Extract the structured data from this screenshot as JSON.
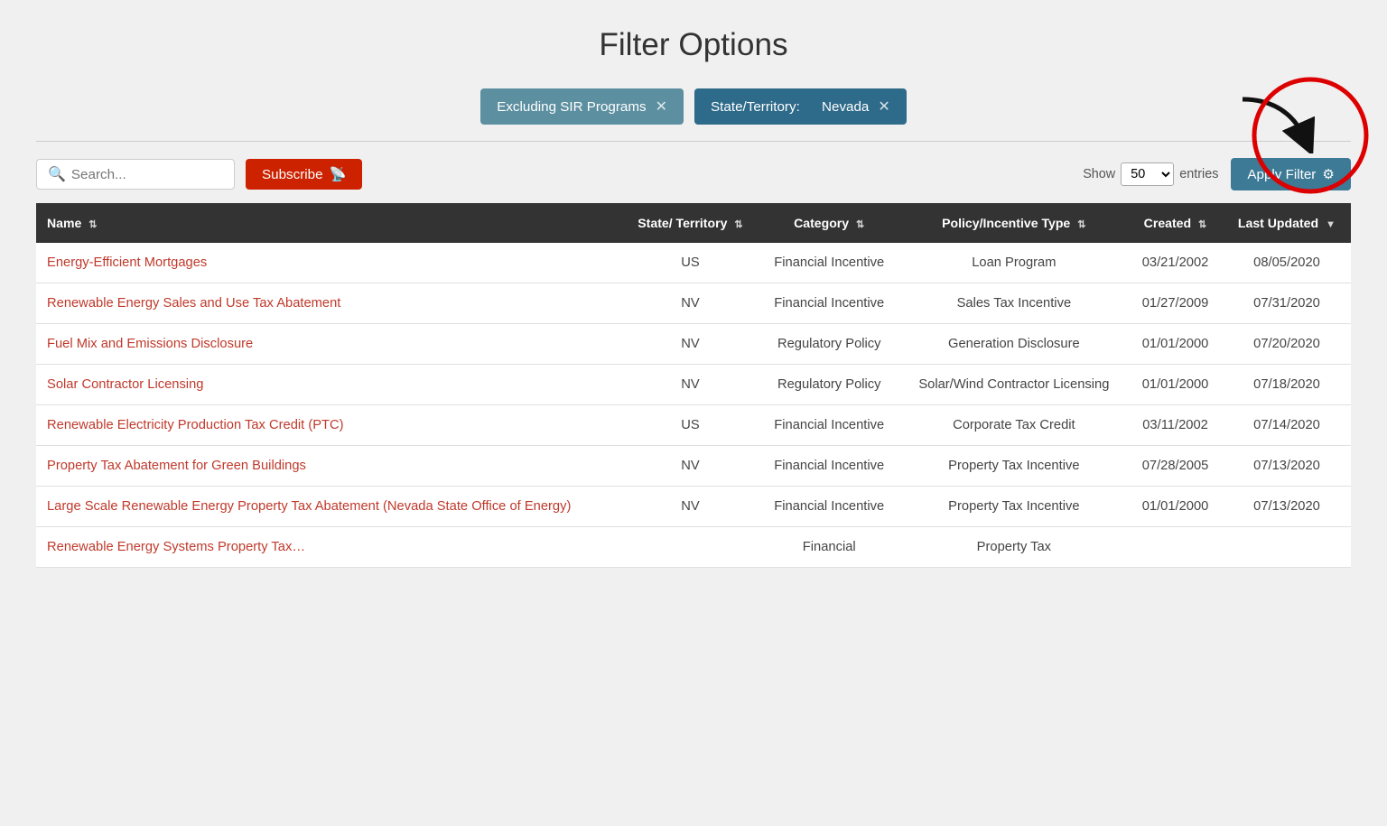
{
  "page": {
    "title": "Filter Options"
  },
  "filter_tags": [
    {
      "id": "sir",
      "style": "muted",
      "label": "Excluding SIR Programs",
      "has_close": true
    },
    {
      "id": "state",
      "style": "dark",
      "label_key": "State/Territory:",
      "label_value": "Nevada",
      "has_close": true
    }
  ],
  "toolbar": {
    "search_placeholder": "Search...",
    "subscribe_label": "Subscribe",
    "show_label": "Show",
    "entries_label": "entries",
    "show_value": "50",
    "apply_filter_label": "Apply Filter"
  },
  "table": {
    "columns": [
      {
        "id": "name",
        "label": "Name",
        "sortable": true
      },
      {
        "id": "state",
        "label": "State/ Territory",
        "sortable": true
      },
      {
        "id": "category",
        "label": "Category",
        "sortable": true
      },
      {
        "id": "policy_type",
        "label": "Policy/Incentive Type",
        "sortable": true
      },
      {
        "id": "created",
        "label": "Created",
        "sortable": true
      },
      {
        "id": "last_updated",
        "label": "Last Updated",
        "sortable": true,
        "active_sort": true
      }
    ],
    "rows": [
      {
        "name": "Energy-Efficient Mortgages",
        "state": "US",
        "category": "Financial Incentive",
        "policy_type": "Loan Program",
        "created": "03/21/2002",
        "last_updated": "08/05/2020"
      },
      {
        "name": "Renewable Energy Sales and Use Tax Abatement",
        "state": "NV",
        "category": "Financial Incentive",
        "policy_type": "Sales Tax Incentive",
        "created": "01/27/2009",
        "last_updated": "07/31/2020"
      },
      {
        "name": "Fuel Mix and Emissions Disclosure",
        "state": "NV",
        "category": "Regulatory Policy",
        "policy_type": "Generation Disclosure",
        "created": "01/01/2000",
        "last_updated": "07/20/2020"
      },
      {
        "name": "Solar Contractor Licensing",
        "state": "NV",
        "category": "Regulatory Policy",
        "policy_type": "Solar/Wind Contractor Licensing",
        "created": "01/01/2000",
        "last_updated": "07/18/2020"
      },
      {
        "name": "Renewable Electricity Production Tax Credit (PTC)",
        "state": "US",
        "category": "Financial Incentive",
        "policy_type": "Corporate Tax Credit",
        "created": "03/11/2002",
        "last_updated": "07/14/2020"
      },
      {
        "name": "Property Tax Abatement for Green Buildings",
        "state": "NV",
        "category": "Financial Incentive",
        "policy_type": "Property Tax Incentive",
        "created": "07/28/2005",
        "last_updated": "07/13/2020"
      },
      {
        "name": "Large Scale Renewable Energy Property Tax Abatement (Nevada State Office of Energy)",
        "state": "NV",
        "category": "Financial Incentive",
        "policy_type": "Property Tax Incentive",
        "created": "01/01/2000",
        "last_updated": "07/13/2020"
      },
      {
        "name": "Renewable Energy Systems Property Tax…",
        "state": "",
        "category": "Financial",
        "policy_type": "Property Tax",
        "created": "",
        "last_updated": ""
      }
    ]
  }
}
